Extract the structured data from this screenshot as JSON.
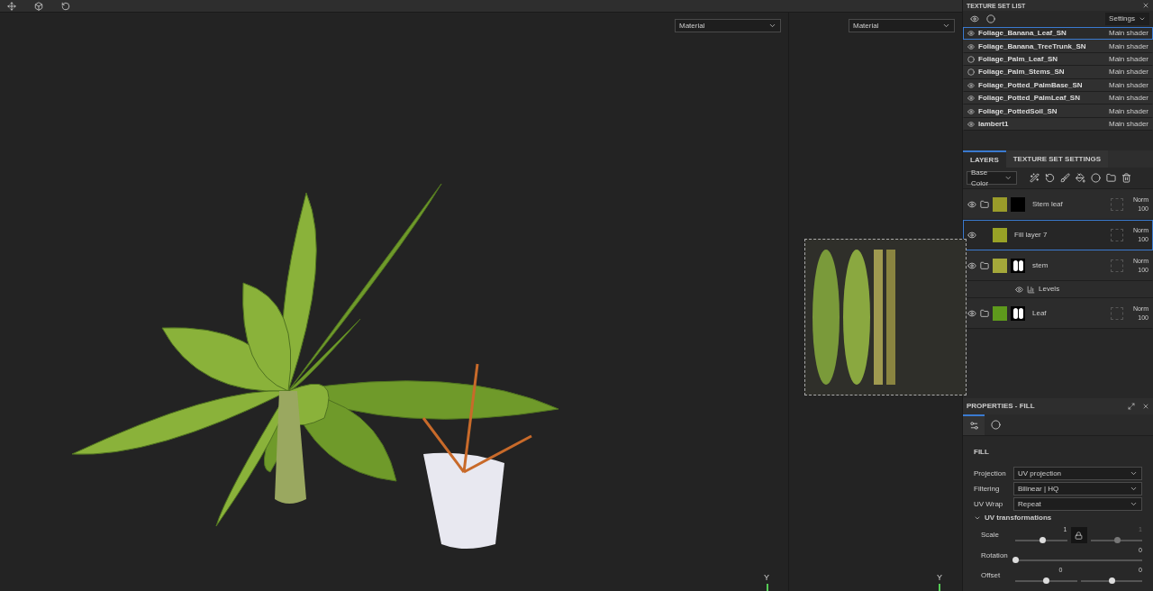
{
  "viewport_3d": {
    "channel": "Material",
    "axis": "Y"
  },
  "viewport_2d": {
    "channel": "Material",
    "axis": "Y"
  },
  "texture_set_list": {
    "title": "TEXTURE SET LIST",
    "settings": "Settings",
    "sets": [
      {
        "name": "Foliage_Banana_Leaf_SN",
        "shader": "Main shader",
        "visible": true,
        "selected": true
      },
      {
        "name": "Foliage_Banana_TreeTrunk_SN",
        "shader": "Main shader",
        "visible": true,
        "selected": false
      },
      {
        "name": "Foliage_Palm_Leaf_SN",
        "shader": "Main shader",
        "visible": false,
        "selected": false
      },
      {
        "name": "Foliage_Palm_Stems_SN",
        "shader": "Main shader",
        "visible": false,
        "selected": false
      },
      {
        "name": "Foliage_Potted_PalmBase_SN",
        "shader": "Main shader",
        "visible": true,
        "selected": false
      },
      {
        "name": "Foliage_Potted_PalmLeaf_SN",
        "shader": "Main shader",
        "visible": true,
        "selected": false
      },
      {
        "name": "Foliage_PottedSoil_SN",
        "shader": "Main shader",
        "visible": true,
        "selected": false
      },
      {
        "name": "lambert1",
        "shader": "Main shader",
        "visible": true,
        "selected": false
      }
    ]
  },
  "layers_panel": {
    "tabs": [
      {
        "label": "LAYERS",
        "selected": true
      },
      {
        "label": "TEXTURE SET SETTINGS",
        "selected": false
      }
    ],
    "channel": "Base Color",
    "layers": [
      {
        "name": "Stem leaf",
        "kind": "folder",
        "visible": true,
        "selected": false,
        "color": "#9a9c2a",
        "mask": {
          "kind": "black"
        },
        "blend": "Norm",
        "opacity": "100"
      },
      {
        "name": "Fill layer 7",
        "kind": "fill",
        "visible": true,
        "selected": true,
        "color": "#98a226",
        "mask": {
          "kind": "none"
        },
        "blend": "Norm",
        "opacity": "100"
      },
      {
        "name": "stem",
        "kind": "folder",
        "visible": true,
        "selected": false,
        "color": "#a4a83a",
        "mask": {
          "kind": "shapes"
        },
        "blend": "Norm",
        "opacity": "100",
        "children": [
          {
            "name": "Levels",
            "kind": "effect",
            "visible": true
          }
        ]
      },
      {
        "name": "Leaf",
        "kind": "folder",
        "visible": true,
        "selected": false,
        "color": "#5e9a1c",
        "mask": {
          "kind": "shapes"
        },
        "blend": "Norm",
        "opacity": "100"
      }
    ]
  },
  "properties": {
    "title": "PROPERTIES - FILL",
    "tabs": [
      {
        "kind": "settings",
        "selected": true
      },
      {
        "kind": "material",
        "selected": false
      }
    ],
    "section": "FILL",
    "fields": [
      {
        "label": "Projection",
        "value": "UV projection"
      },
      {
        "label": "Filtering",
        "value": "Bilinear | HQ"
      },
      {
        "label": "UV Wrap",
        "value": "Repeat"
      }
    ],
    "group": {
      "label": "UV transformations",
      "expanded": true
    },
    "scale": {
      "label": "Scale",
      "locked": true,
      "sliders": [
        {
          "value": "1",
          "level": 0.52
        },
        {
          "value": "1",
          "level": 0.52
        }
      ]
    },
    "rotation": {
      "label": "Rotation",
      "value": "0",
      "level": 0
    },
    "offset": {
      "label": "Offset",
      "sliders": [
        {
          "value": "0",
          "level": 0.5
        },
        {
          "value": "0",
          "level": 0.5
        }
      ]
    }
  }
}
